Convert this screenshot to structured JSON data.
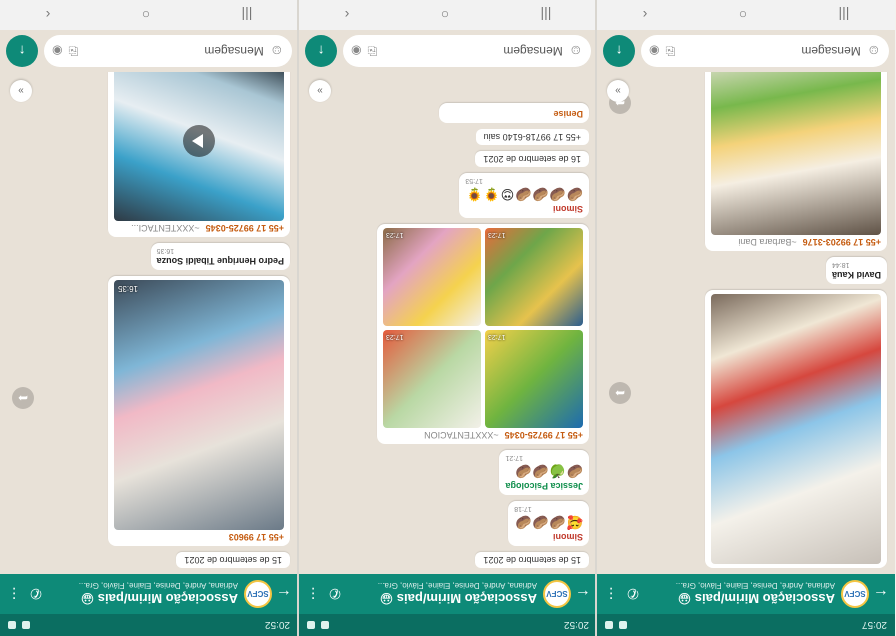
{
  "status": {
    "time_left": "20:52",
    "time_middle": "20:52",
    "time_right": "20:57"
  },
  "chat": {
    "title": "Associação Mirim/pais",
    "title_emoji": "😀",
    "subtitle": "Adriana, André, Denise, Elaine, Flávio, Gra...",
    "avatar_text": "SCFV"
  },
  "composer": {
    "placeholder": "Mensagem"
  },
  "panel_left": {
    "date": "15 de setembro de 2021",
    "msg1": {
      "sender": "+55 17 99603",
      "time": "16:35"
    },
    "msg2": {
      "sender": "Pedro Henrique Tibaldi Souza",
      "time": "16:35"
    },
    "msg3": {
      "sender": "+55 17 99725-0345",
      "alias": "~XXXTENTACI..."
    }
  },
  "panel_middle": {
    "date1": "15 de setembro de 2021",
    "m1": {
      "sender": "Simoni",
      "emojis": "🥰🥔🥔🥔",
      "time": "17:18"
    },
    "m2": {
      "sender": "Jessica Psicologa",
      "emojis": "🥔🍏🥔🥔",
      "time": "17:21"
    },
    "m3": {
      "sender": "+55 17 99725-0345",
      "alias": "~XXXTENTACION",
      "times": [
        "17:23",
        "17:23",
        "17:23",
        "17:23"
      ]
    },
    "m4": {
      "sender": "Simoni",
      "emojis": "🥔🥔🥔🥔😍🌻🌻",
      "time": "17:53"
    },
    "date2": "16 de setembro de 2021",
    "sys": "+55 17 99718-6140 saiu",
    "m5": {
      "sender": "Denise"
    }
  },
  "panel_right": {
    "msg1": {
      "sender": "David Kauã",
      "time": "18:44"
    },
    "msg2": {
      "sender": "+55 17 99203-3176",
      "alias": "~Barbara Dani"
    }
  }
}
